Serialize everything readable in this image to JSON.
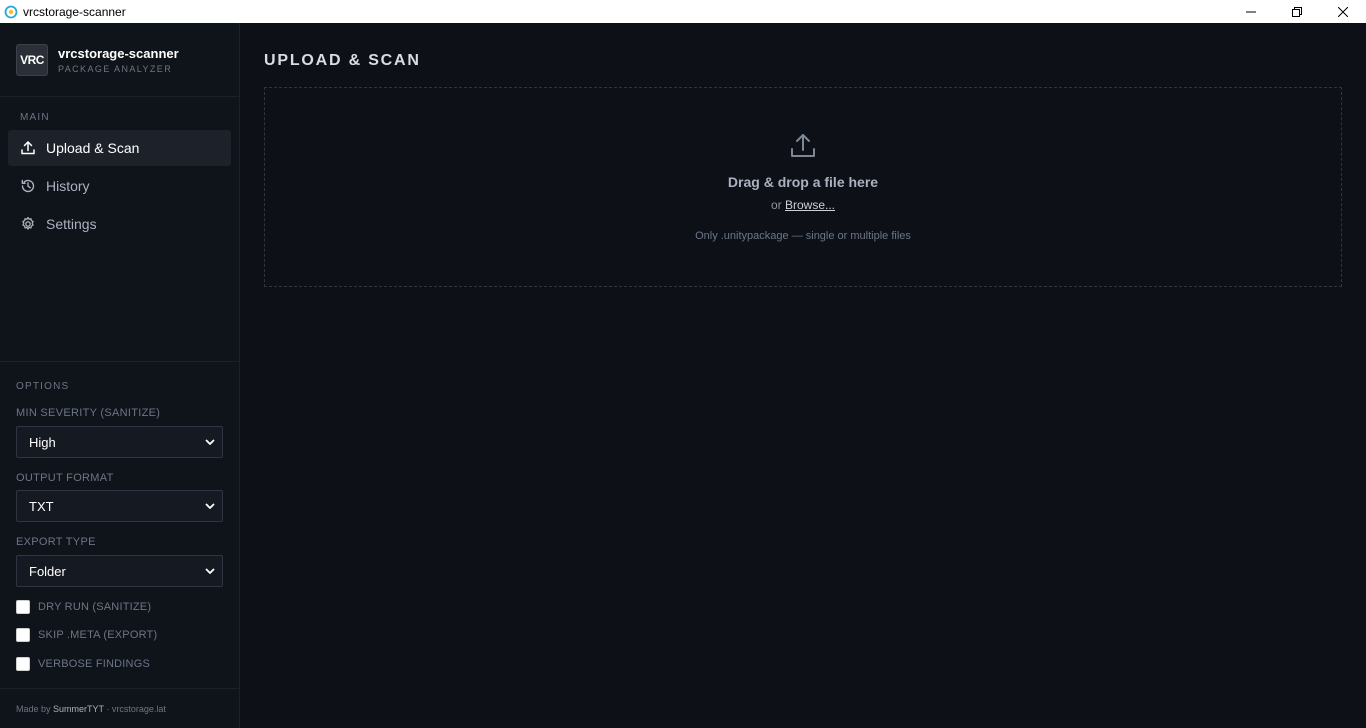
{
  "window": {
    "title": "vrcstorage-scanner"
  },
  "brand": {
    "logo_text": "VRC",
    "name": "vrcstorage-scanner",
    "subtitle": "PACKAGE ANALYZER"
  },
  "sidebar": {
    "main_label": "MAIN",
    "items": [
      {
        "label": "Upload & Scan",
        "icon": "upload-icon",
        "active": true
      },
      {
        "label": "History",
        "icon": "history-icon",
        "active": false
      },
      {
        "label": "Settings",
        "icon": "gear-icon",
        "active": false
      }
    ],
    "options_label": "OPTIONS",
    "options": {
      "min_severity": {
        "label": "MIN SEVERITY (SANITIZE)",
        "value": "High"
      },
      "output_format": {
        "label": "OUTPUT FORMAT",
        "value": "TXT"
      },
      "export_type": {
        "label": "EXPORT TYPE",
        "value": "Folder"
      }
    },
    "checkboxes": [
      {
        "label": "DRY RUN (SANITIZE)",
        "checked": false
      },
      {
        "label": "SKIP .META (EXPORT)",
        "checked": false
      },
      {
        "label": "VERBOSE FINDINGS",
        "checked": false
      }
    ],
    "footer": {
      "made_by": "Made by ",
      "author": "SummerTYT",
      "separator": " · ",
      "site": "vrcstorage.lat"
    }
  },
  "main": {
    "title": "UPLOAD & SCAN",
    "dropzone": {
      "title": "Drag & drop a file here",
      "or_text": "or ",
      "browse_label": "Browse...",
      "hint": "Only .unitypackage — single or multiple files"
    }
  },
  "colors": {
    "background": "#0d1017",
    "sidebar": "#0f131a",
    "active_item": "#1c212a",
    "muted_text": "#6c7686"
  }
}
